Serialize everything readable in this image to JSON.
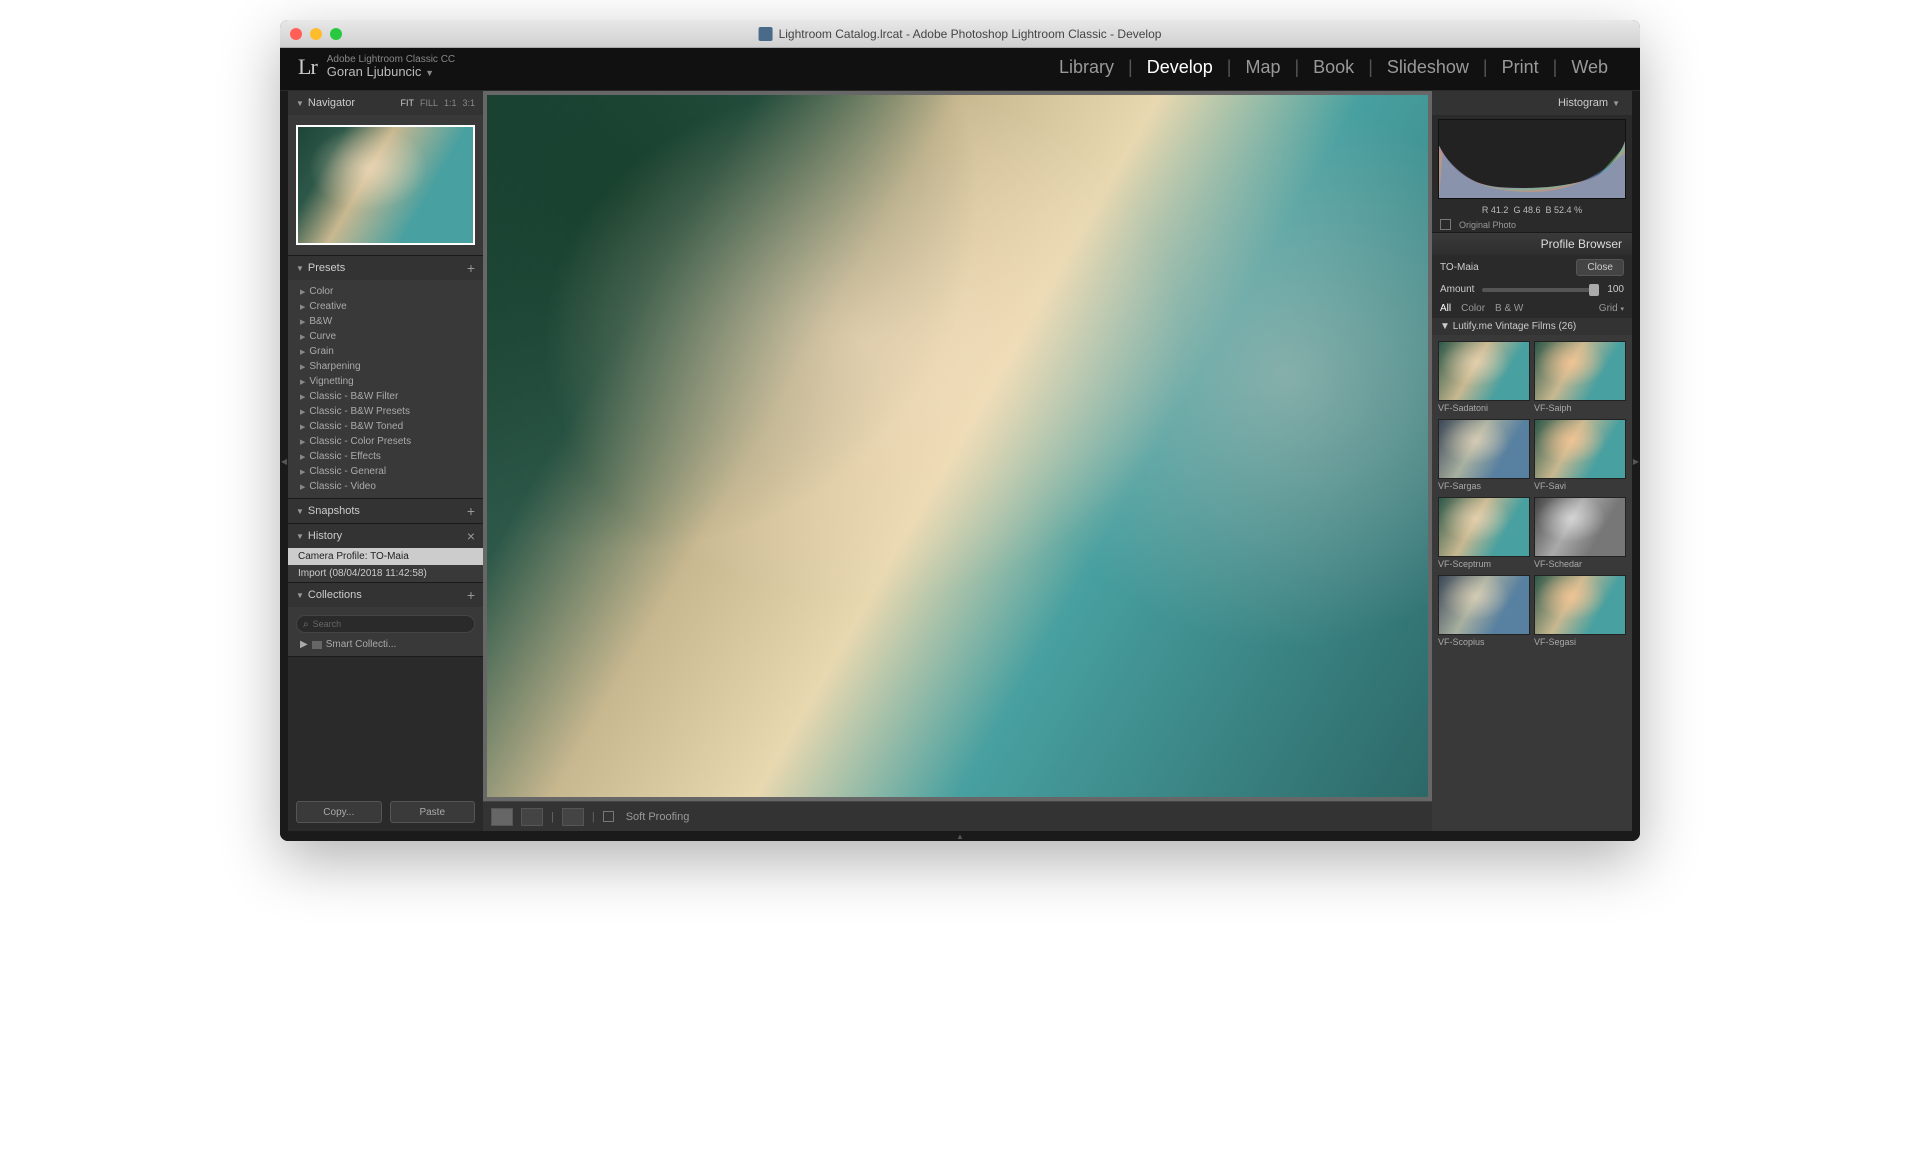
{
  "window": {
    "title": "Lightroom Catalog.lrcat - Adobe Photoshop Lightroom Classic - Develop"
  },
  "header": {
    "logo": "Lr",
    "product": "Adobe Lightroom Classic CC",
    "user": "Goran Ljubuncic",
    "modules": [
      "Library",
      "Develop",
      "Map",
      "Book",
      "Slideshow",
      "Print",
      "Web"
    ],
    "active_module": "Develop"
  },
  "left": {
    "navigator": {
      "title": "Navigator",
      "opts": [
        "FIT",
        "FILL",
        "1:1",
        "3:1"
      ],
      "active": "FIT"
    },
    "presets": {
      "title": "Presets",
      "items": [
        "Color",
        "Creative",
        "B&W",
        "Curve",
        "Grain",
        "Sharpening",
        "Vignetting",
        "Classic - B&W Filter",
        "Classic - B&W Presets",
        "Classic - B&W Toned",
        "Classic - Color Presets",
        "Classic - Effects",
        "Classic - General",
        "Classic - Video"
      ]
    },
    "snapshots": {
      "title": "Snapshots"
    },
    "history": {
      "title": "History",
      "items": [
        "Camera Profile: TO-Maia",
        "Import (08/04/2018 11:42:58)"
      ],
      "selected": 0
    },
    "collections": {
      "title": "Collections",
      "search_placeholder": "Search",
      "item": "Smart Collecti..."
    },
    "buttons": {
      "copy": "Copy...",
      "paste": "Paste"
    }
  },
  "toolbar": {
    "soft_proof": "Soft Proofing"
  },
  "right": {
    "histogram": {
      "title": "Histogram",
      "rgb": {
        "r": "41.2",
        "g": "48.6",
        "b": "52.4",
        "pct": "%"
      },
      "original": "Original Photo"
    },
    "profile": {
      "title": "Profile Browser",
      "name": "TO-Maia",
      "close": "Close",
      "amount_label": "Amount",
      "amount_value": "100",
      "filters": [
        "All",
        "Color",
        "B & W"
      ],
      "active_filter": "All",
      "view": "Grid",
      "group": "Lutify.me Vintage Films (26)",
      "thumbs": [
        "VF-Sadatoni",
        "VF-Saiph",
        "VF-Sargas",
        "VF-Savi",
        "VF-Sceptrum",
        "VF-Schedar",
        "VF-Scopius",
        "VF-Segasi"
      ]
    }
  }
}
